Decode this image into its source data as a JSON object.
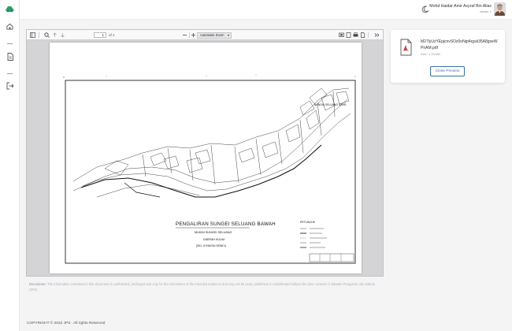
{
  "user": {
    "name": "Mohd Haidar Amir Asyraf Bin Alias",
    "role": "viewer 1"
  },
  "viewer": {
    "page_number": "1",
    "page_of": "of 1",
    "zoom": "Automatic Zoom"
  },
  "document": {
    "title": "PENGALIRAN SUNGEI SELUANG BAWAH",
    "subtitle": "MUKIM SUNGEI SELUANG",
    "district": "DAERAH KULIM",
    "scale": "(SKL. 8 RANTAI SEINCI)",
    "area_label": "SUNGAI SELUANG BAHR",
    "legend_title": "PETUNJUK"
  },
  "disclaimer": {
    "label": "Disclaimer:",
    "text": "The information contained in this document is confidential, privileged and only for the information of the intended audience and may not be used, published or redistributed without the prior consent of Jabatan Pengairan dan Saliran (JPS)."
  },
  "footer": {
    "copyright": "COPYRIGHT © 2022 JPS . All rights Reserved"
  },
  "preview": {
    "file_name": "M27lyUzYEpjcnvSOz0oNgt4rgsk35A8gseWPnAM.pdf",
    "file_size": "Size: 1.33 MB",
    "close_label": "Close Preview"
  }
}
